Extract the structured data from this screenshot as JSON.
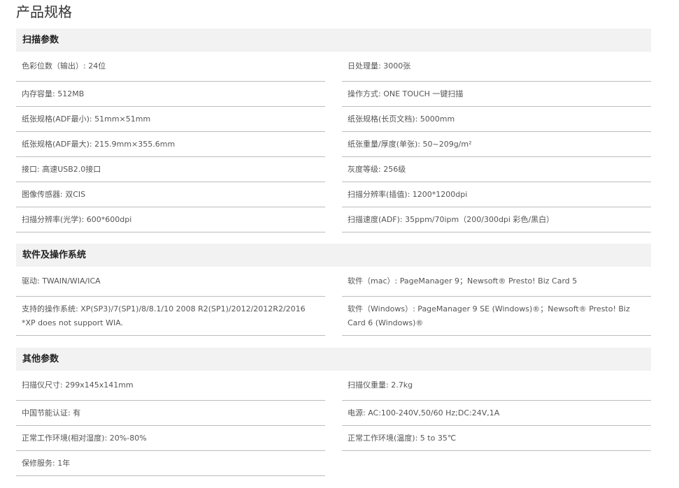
{
  "page_title": "产品规格",
  "sections": {
    "scan": {
      "title": "扫描参数",
      "rows": [
        [
          "色彩位数（输出）: 24位",
          "日处理量: 3000张"
        ],
        [
          "内存容量: 512MB",
          "操作方式: ONE TOUCH 一键扫描"
        ],
        [
          "纸张规格(ADF最小): 51mm×51mm",
          "纸张规格(长页文档): 5000mm"
        ],
        [
          "纸张规格(ADF最大): 215.9mm×355.6mm",
          "纸张重量/厚度(单张): 50~209g/m²"
        ],
        [
          "接口: 高速USB2.0接口",
          "灰度等级: 256级"
        ],
        [
          "图像传感器: 双CIS",
          "扫描分辨率(插值): 1200*1200dpi"
        ],
        [
          "扫描分辨率(光学): 600*600dpi",
          "扫描速度(ADF): 35ppm/70ipm（200/300dpi 彩色/黑白）"
        ]
      ]
    },
    "software": {
      "title": "软件及操作系统",
      "rows": [
        [
          "驱动: TWAIN/WIA/ICA",
          "软件（mac）: PageManager 9；Newsoft® Presto! Biz Card 5"
        ],
        [
          "支持的操作系统: XP(SP3)/7(SP1)/8/8.1/10 2008 R2(SP1)/2012/2012R2/2016 *XP does not support WIA.",
          "软件（Windows）: PageManager 9 SE (Windows)®；Newsoft® Presto! Biz Card 6 (Windows)®"
        ]
      ]
    },
    "other": {
      "title": "其他参数",
      "rows": [
        [
          "扫描仪尺寸: 299x145x141mm",
          "扫描仪重量: 2.7kg"
        ],
        [
          "中国节能认证: 有",
          "电源: AC:100-240V,50/60 Hz;DC:24V,1A"
        ],
        [
          "正常工作环境(相对湿度): 20%-80%",
          "正常工作环境(温度): 5 to 35℃"
        ],
        [
          "保修服务: 1年",
          ""
        ]
      ]
    }
  }
}
